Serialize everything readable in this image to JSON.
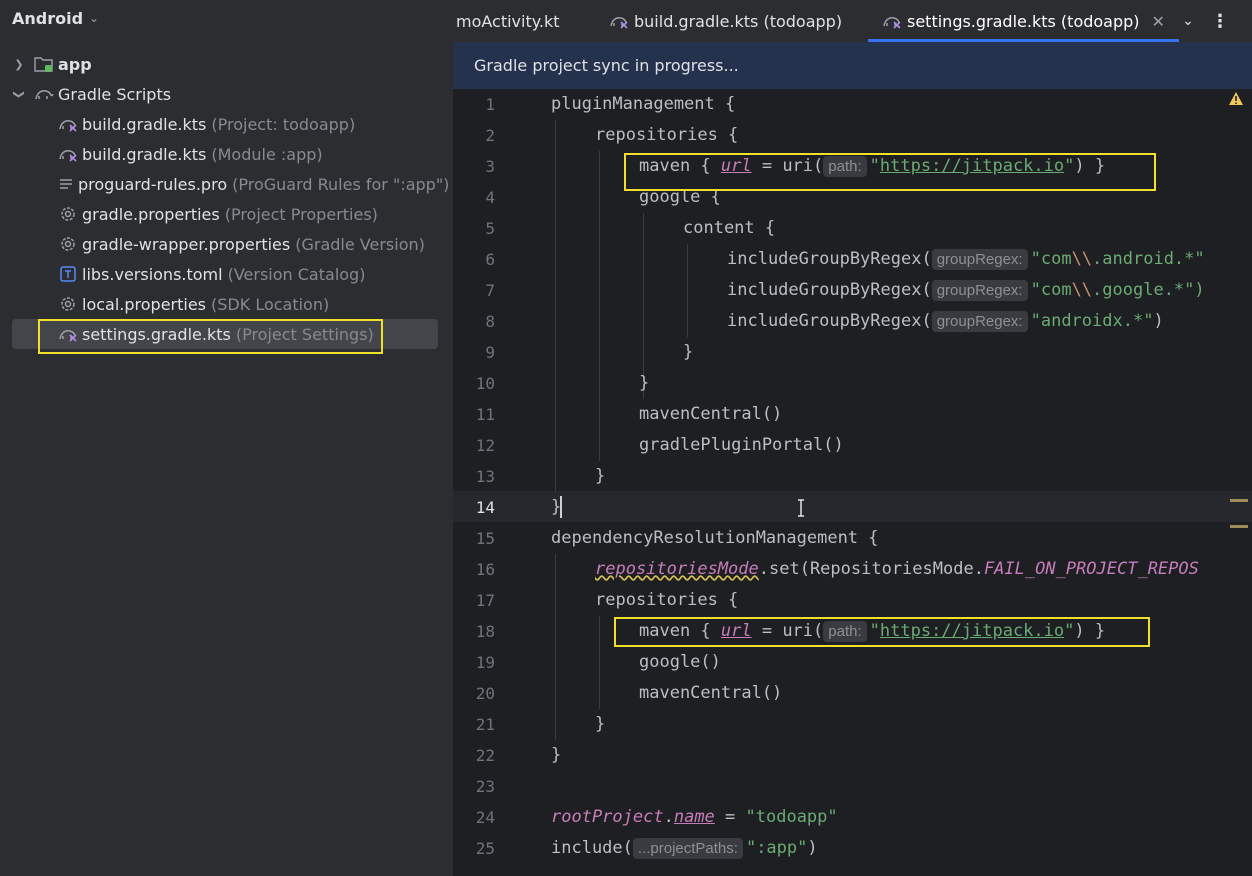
{
  "project_view": {
    "title": "Android",
    "tree": [
      {
        "name": "app",
        "hint": ""
      },
      {
        "name": "Gradle Scripts",
        "hint": ""
      },
      {
        "name": "build.gradle.kts",
        "hint": "(Project: todoapp)"
      },
      {
        "name": "build.gradle.kts",
        "hint": "(Module :app)"
      },
      {
        "name": "proguard-rules.pro",
        "hint": "(ProGuard Rules for \":app\")"
      },
      {
        "name": "gradle.properties",
        "hint": "(Project Properties)"
      },
      {
        "name": "gradle-wrapper.properties",
        "hint": "(Gradle Version)"
      },
      {
        "name": "libs.versions.toml",
        "hint": "(Version Catalog)"
      },
      {
        "name": "local.properties",
        "hint": "(SDK Location)"
      },
      {
        "name": "settings.gradle.kts",
        "hint": "(Project Settings)"
      }
    ]
  },
  "tabs": [
    {
      "label": "moActivity.kt"
    },
    {
      "label": "build.gradle.kts (todoapp)"
    },
    {
      "label": "settings.gradle.kts (todoapp)"
    }
  ],
  "banner": "Gradle project sync in progress...",
  "current_line": 14,
  "line_numbers": [
    "1",
    "2",
    "3",
    "4",
    "5",
    "6",
    "7",
    "8",
    "9",
    "10",
    "11",
    "12",
    "13",
    "14",
    "15",
    "16",
    "17",
    "18",
    "19",
    "20",
    "21",
    "22",
    "23",
    "24",
    "25"
  ],
  "code": {
    "l1": "pluginManagement {",
    "l2": "repositories {",
    "l3a": "maven { ",
    "l3b": "url",
    "l3c": " = uri(",
    "l3hint": "path:",
    "l3q1": "\"",
    "l3url": "https://jitpack.io",
    "l3q2": "\"",
    "l3d": ") }",
    "l4": "google {",
    "l5": "content {",
    "l6a": "includeGroupByRegex(",
    "l6hint": "groupRegex:",
    "l6s1": "\"com",
    "l6esc": "\\\\",
    "l6s2": ".android.*\"",
    "l7a": "includeGroupByRegex(",
    "l7hint": "groupRegex:",
    "l7s1": "\"com",
    "l7esc": "\\\\",
    "l7s2": ".google.*\")",
    "l8a": "includeGroupByRegex(",
    "l8hint": "groupRegex:",
    "l8s": "\"androidx.*\"",
    "l8b": ")",
    "l9": "}",
    "l10": "}",
    "l11": "mavenCentral()",
    "l12": "gradlePluginPortal()",
    "l13": "}",
    "l14": "}",
    "l15": "dependencyResolutionManagement {",
    "l16a": "repositoriesMode",
    "l16b": ".set(RepositoriesMode.",
    "l16c": "FAIL_ON_PROJECT_REPOS",
    "l17": "repositories {",
    "l18a": "maven { ",
    "l18b": "url",
    "l18c": " = uri(",
    "l18hint": "path:",
    "l18q1": "\"",
    "l18url": "https://jitpack.io",
    "l18q2": "\"",
    "l18d": ") }",
    "l19": "google()",
    "l20": "mavenCentral()",
    "l21": "}",
    "l22": "}",
    "l23": "",
    "l24a": "rootProject",
    "l24b": ".",
    "l24c": "name",
    "l24d": " = ",
    "l24s": "\"todoapp\"",
    "l25a": "include(",
    "l25hint": "...projectPaths:",
    "l25s": "\":app\"",
    "l25b": ")"
  },
  "colors": {
    "accent": "#3574f0",
    "highlight_box": "#f0e02b",
    "string": "#6aab73",
    "property": "#c77dbb",
    "banner_bg": "#25324d"
  }
}
